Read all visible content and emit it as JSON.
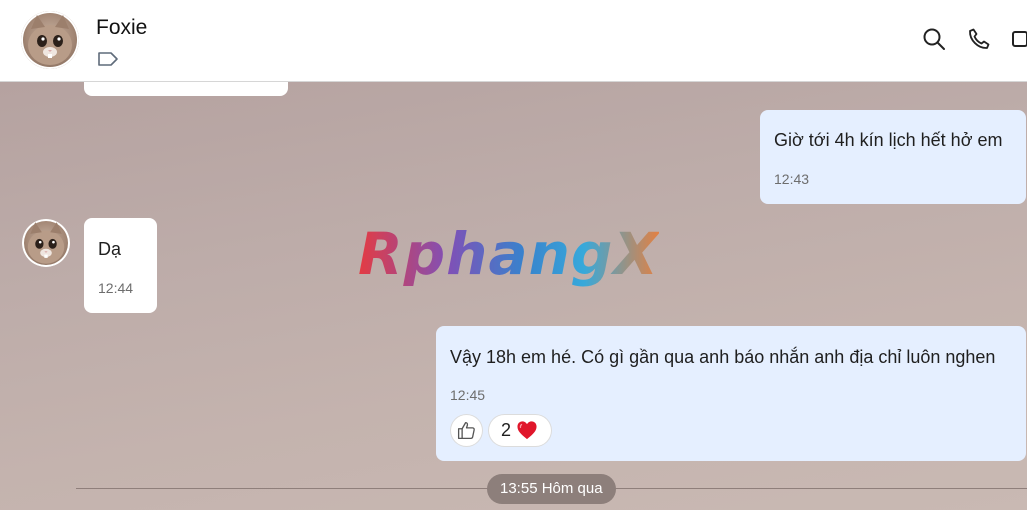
{
  "header": {
    "contact_name": "Foxie",
    "avatar_icon": "cat-avatar",
    "label_icon": "tag-icon",
    "actions": [
      "search-icon",
      "phone-icon",
      "video-icon"
    ]
  },
  "messages": [
    {
      "direction": "outgoing",
      "text": "Giờ tới 4h kín lịch hết hở em",
      "time": "12:43"
    },
    {
      "direction": "incoming",
      "text": "Dạ",
      "time": "12:44"
    },
    {
      "direction": "outgoing",
      "text": "Vậy 18h em hé. Có gì gần qua anh báo nhắn anh địa chỉ luôn nghen",
      "time": "12:45",
      "reactions": {
        "like_icon": "thumbs-up-icon",
        "count": "2",
        "emoji": "heart"
      }
    }
  ],
  "watermark": "RphangX",
  "day_separator": "13:55 Hôm qua",
  "colors": {
    "incoming_bubble": "#ffffff",
    "outgoing_bubble": "#e5efff",
    "chat_background": "#bdaca9",
    "heart": "#e0162b"
  }
}
